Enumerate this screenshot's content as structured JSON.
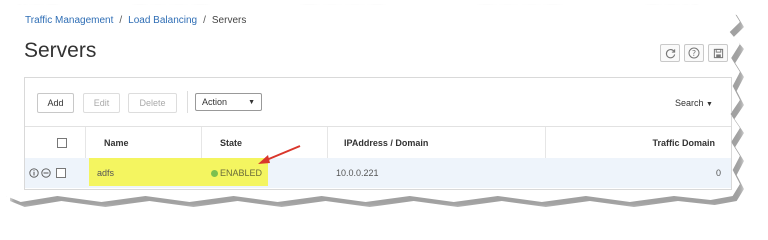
{
  "breadcrumb": {
    "item1": "Traffic Management",
    "item2": "Load Balancing",
    "item3": "Servers",
    "separator": "/"
  },
  "page": {
    "title": "Servers"
  },
  "toolbar": {
    "add": "Add",
    "edit": "Edit",
    "delete": "Delete",
    "action": "Action",
    "search": "Search"
  },
  "table": {
    "headers": {
      "name": "Name",
      "state": "State",
      "ip": "IPAddress / Domain",
      "traffic_domain": "Traffic Domain"
    },
    "rows": [
      {
        "name": "adfs",
        "state": "ENABLED",
        "ip": "10.0.0.221",
        "traffic_domain": "0"
      }
    ]
  },
  "colors": {
    "link": "#2f6eb5",
    "highlight": "#f4f560",
    "enabled_dot": "#7cc04f",
    "arrow": "#d9362b",
    "row_bg": "#eef4fb"
  },
  "icons": [
    "refresh-icon",
    "help-icon",
    "save-icon",
    "info-icon",
    "minus-circle-icon",
    "checkbox-icon",
    "caret-down-icon",
    "status-dot-icon",
    "arrow-annotation"
  ]
}
